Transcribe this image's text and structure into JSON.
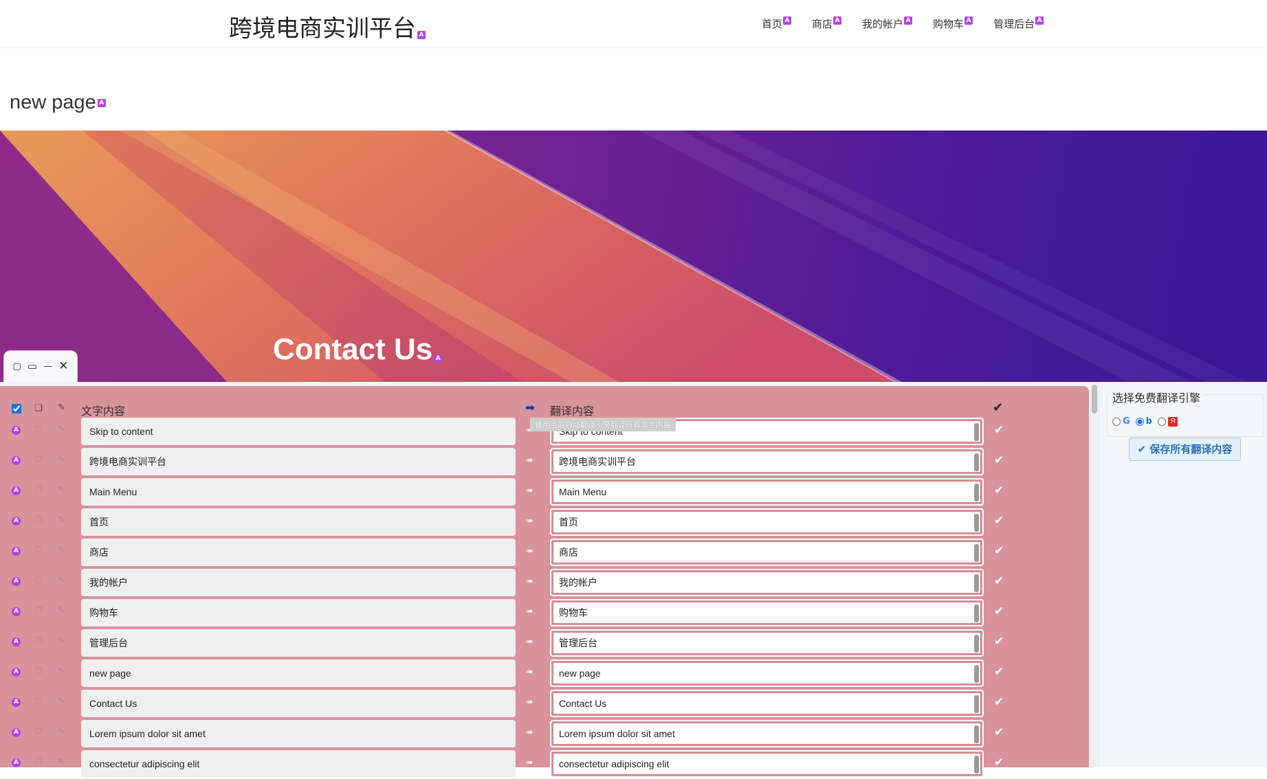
{
  "header": {
    "site_title": "跨境电商实训平台",
    "badge": "A",
    "nav": [
      {
        "label": "首页"
      },
      {
        "label": "商店"
      },
      {
        "label": "我的帐户"
      },
      {
        "label": "购物车"
      },
      {
        "label": "管理后台"
      }
    ]
  },
  "page": {
    "title": "new page"
  },
  "hero": {
    "title": "Contact Us"
  },
  "window_controls": {
    "restore": "▢",
    "maximize": "▭",
    "minimize": "—",
    "close": "✕"
  },
  "panel": {
    "source_header": "文字内容",
    "target_header": "翻译内容",
    "translate_all_icon": "➡",
    "translate_all_tooltip": "使用当前自动翻译引擎翻译所有文字内容",
    "confirm_icon": "✔",
    "row_arrow": "➠",
    "rows": [
      {
        "source": "Skip to content",
        "target": "Skip to content"
      },
      {
        "source": "跨境电商实训平台",
        "target": "跨境电商实训平台"
      },
      {
        "source": "Main Menu",
        "target": "Main Menu"
      },
      {
        "source": "首页",
        "target": "首页"
      },
      {
        "source": "商店",
        "target": "商店"
      },
      {
        "source": "我的帐户",
        "target": "我的帐户"
      },
      {
        "source": "购物车",
        "target": "购物车"
      },
      {
        "source": "管理后台",
        "target": "管理后台"
      },
      {
        "source": "new page",
        "target": "new page"
      },
      {
        "source": "Contact Us",
        "target": "Contact Us"
      },
      {
        "source": "Lorem ipsum dolor sit amet",
        "target": "Lorem ipsum dolor sit amet"
      },
      {
        "source": "consectetur adipiscing elit",
        "target": "consectetur adipiscing elit"
      }
    ]
  },
  "sidebar": {
    "engine_legend": "选择免费翻译引擎",
    "engines": [
      {
        "name": "google",
        "glyph": "G",
        "selected": false
      },
      {
        "name": "bing",
        "glyph": "b",
        "selected": true
      },
      {
        "name": "yandex",
        "glyph": "Я",
        "selected": false
      }
    ],
    "save_label": "✔ 保存所有翻译内容"
  },
  "colors": {
    "panel_bg": "#d8939b",
    "badge": "#b044e8",
    "save_button_text": "#2a6fb6",
    "hero_purple": "#4a1a98",
    "hero_orange": "#e08a58"
  }
}
